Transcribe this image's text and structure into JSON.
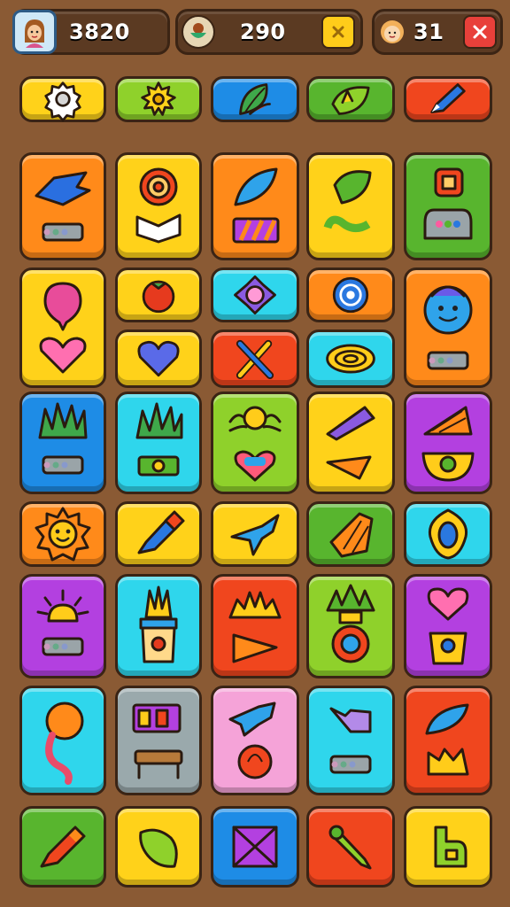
{
  "hud": {
    "coins": "3820",
    "gems": "290",
    "lives": "31"
  },
  "colors": {
    "yellow": "#ffd21a",
    "lime": "#8fd12b",
    "blue": "#1e8ce6",
    "green": "#58b52e",
    "red": "#f0461e",
    "orange": "#ff8a1a",
    "cyan": "#2fd6ec",
    "purple": "#b340e0",
    "pink": "#f5a3d8",
    "gray": "#9aa9ac"
  },
  "board": {
    "tiles": [
      {
        "name": "tile-gear",
        "color": "yellow",
        "icon": "gear-icon"
      },
      {
        "name": "tile-sun-badge",
        "color": "lime",
        "icon": "sun-badge-icon"
      },
      {
        "name": "tile-leaf",
        "color": "blue",
        "icon": "leaf-icon"
      },
      {
        "name": "tile-green-leaf",
        "color": "green",
        "icon": "green-leaf-icon"
      },
      {
        "name": "tile-pencil",
        "color": "red",
        "icon": "pencil-icon"
      },
      {
        "name": "tile-spaceship-panel",
        "color": "orange",
        "icon": "spaceship-icon"
      },
      {
        "name": "tile-swirl-heart",
        "color": "yellow",
        "icon": "swirl-icon"
      },
      {
        "name": "tile-feather-stripes",
        "color": "orange",
        "icon": "feather-icon"
      },
      {
        "name": "tile-leaf-ring",
        "color": "yellow",
        "icon": "leaf-ring-icon"
      },
      {
        "name": "tile-robot",
        "color": "green",
        "icon": "robot-icon"
      },
      {
        "name": "tile-balloon-heart",
        "color": "yellow",
        "icon": "balloon-icon"
      },
      {
        "name": "tile-tomato",
        "color": "yellow",
        "icon": "tomato-icon"
      },
      {
        "name": "tile-heart",
        "color": "yellow",
        "icon": "heart-icon"
      },
      {
        "name": "tile-star-shell",
        "color": "cyan",
        "icon": "shell-icon"
      },
      {
        "name": "tile-crossed-tools",
        "color": "red",
        "icon": "tools-icon"
      },
      {
        "name": "tile-spiral",
        "color": "orange",
        "icon": "spiral-icon"
      },
      {
        "name": "tile-coil",
        "color": "cyan",
        "icon": "coil-icon"
      },
      {
        "name": "tile-blob-face",
        "color": "orange",
        "icon": "face-icon"
      },
      {
        "name": "tile-grass-panel",
        "color": "blue",
        "icon": "grass-icon"
      },
      {
        "name": "tile-plant-panel",
        "color": "cyan",
        "icon": "plant-icon"
      },
      {
        "name": "tile-spider-heart",
        "color": "lime",
        "icon": "spider-icon"
      },
      {
        "name": "tile-knife",
        "color": "yellow",
        "icon": "knife-icon"
      },
      {
        "name": "tile-fries-pot",
        "color": "purple",
        "icon": "fries-icon"
      },
      {
        "name": "tile-sun-face",
        "color": "orange",
        "icon": "sun-face-icon"
      },
      {
        "name": "tile-brush",
        "color": "yellow",
        "icon": "brush-icon"
      },
      {
        "name": "tile-plane",
        "color": "yellow",
        "icon": "plane-icon"
      },
      {
        "name": "tile-cheese",
        "color": "green",
        "icon": "cheese-icon"
      },
      {
        "name": "tile-ring",
        "color": "cyan",
        "icon": "ring-icon"
      },
      {
        "name": "tile-sunrise-panel",
        "color": "purple",
        "icon": "sunrise-icon"
      },
      {
        "name": "tile-plant-pot",
        "color": "cyan",
        "icon": "pot-icon"
      },
      {
        "name": "tile-sunburst-play",
        "color": "red",
        "icon": "play-icon"
      },
      {
        "name": "tile-pineapple",
        "color": "lime",
        "icon": "pineapple-icon"
      },
      {
        "name": "tile-heart-pot",
        "color": "purple",
        "icon": "heart-pot-icon"
      },
      {
        "name": "tile-balloon",
        "color": "cyan",
        "icon": "balloon-string-icon"
      },
      {
        "name": "tile-furniture",
        "color": "gray",
        "icon": "furniture-icon"
      },
      {
        "name": "tile-fish-target",
        "color": "pink",
        "icon": "fish-icon"
      },
      {
        "name": "tile-camera-panel",
        "color": "cyan",
        "icon": "camera-icon"
      },
      {
        "name": "tile-leaf-basket",
        "color": "red",
        "icon": "basket-icon"
      },
      {
        "name": "tile-marker",
        "color": "green",
        "icon": "marker-icon"
      },
      {
        "name": "tile-lemon",
        "color": "yellow",
        "icon": "lemon-icon"
      },
      {
        "name": "tile-envelope",
        "color": "blue",
        "icon": "envelope-icon"
      },
      {
        "name": "tile-bat",
        "color": "red",
        "icon": "bat-icon"
      },
      {
        "name": "tile-puzzle",
        "color": "yellow",
        "icon": "puzzle-icon"
      }
    ]
  }
}
